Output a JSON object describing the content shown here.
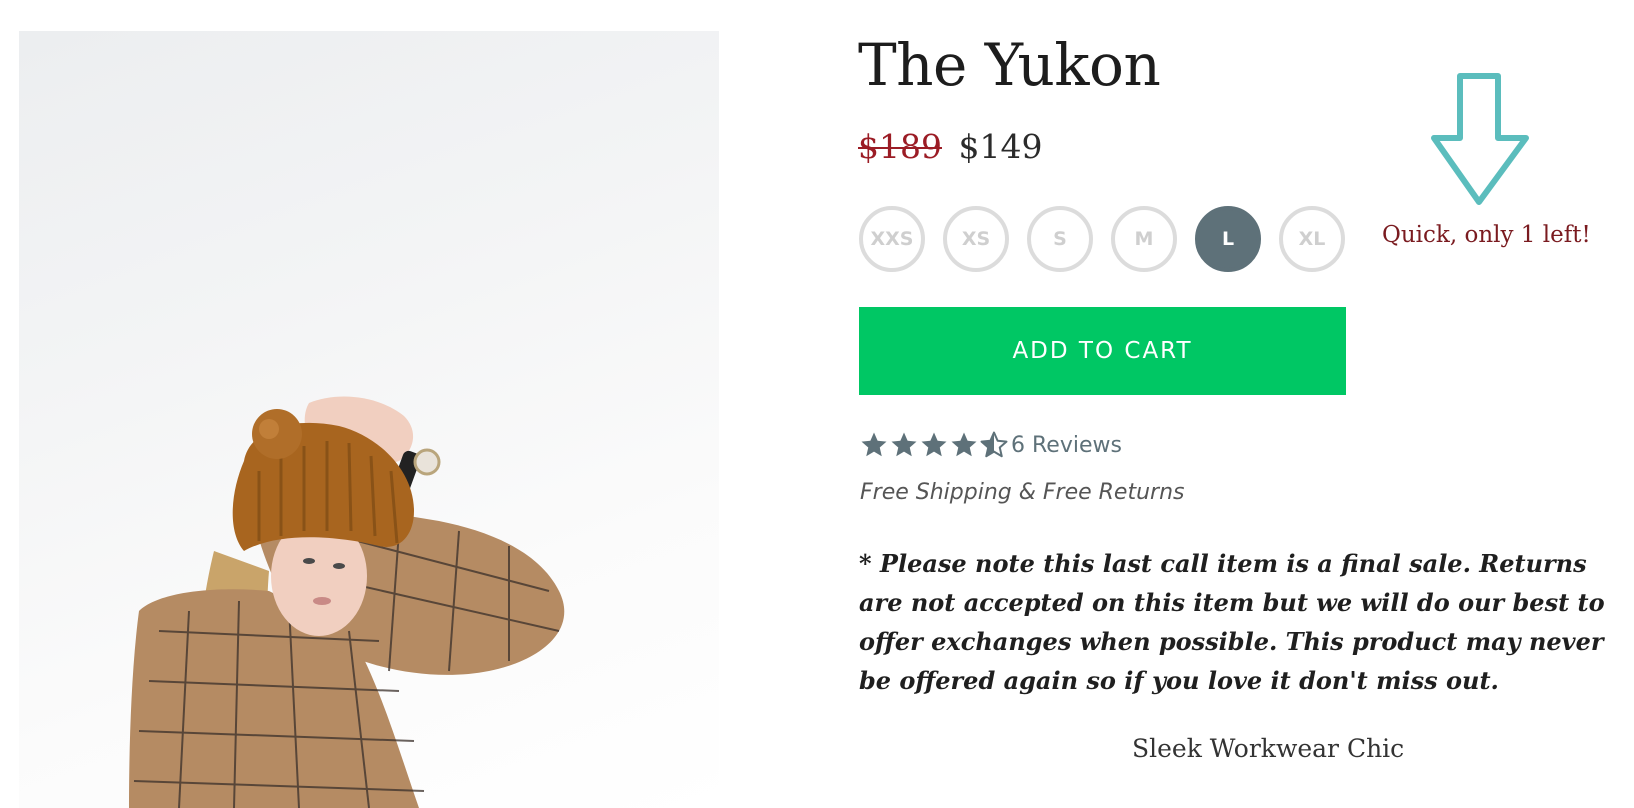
{
  "product": {
    "title": "The Yukon",
    "price_old": "$189",
    "price_new": "$149",
    "sizes": [
      "XXS",
      "XS",
      "S",
      "M",
      "L",
      "XL"
    ],
    "selected_size": "L",
    "stock_note": "Quick, only 1 left!",
    "add_to_cart_label": "ADD TO CART",
    "rating": 4.5,
    "rating_max": 5,
    "reviews_label": "6 Reviews",
    "shipping_text": "Free Shipping & Free Returns",
    "sale_note": "* Please note this last call item is a final sale. Returns are not accepted on this item but we will do our best to offer exchanges when possible. This product may never be offered again so if you love it don't miss out.",
    "subtitle": "Sleek Workwear Chic"
  },
  "colors": {
    "accent_green": "#00c764",
    "selected_size_bg": "#5e7179",
    "old_price": "#9b1c25",
    "stock_note": "#7a1b20",
    "arrow": "#5bbdbd",
    "star": "#5e7179"
  },
  "icons": {
    "arrow": "down-arrow-icon",
    "star_full": "star-icon",
    "star_half": "half-star-icon"
  }
}
